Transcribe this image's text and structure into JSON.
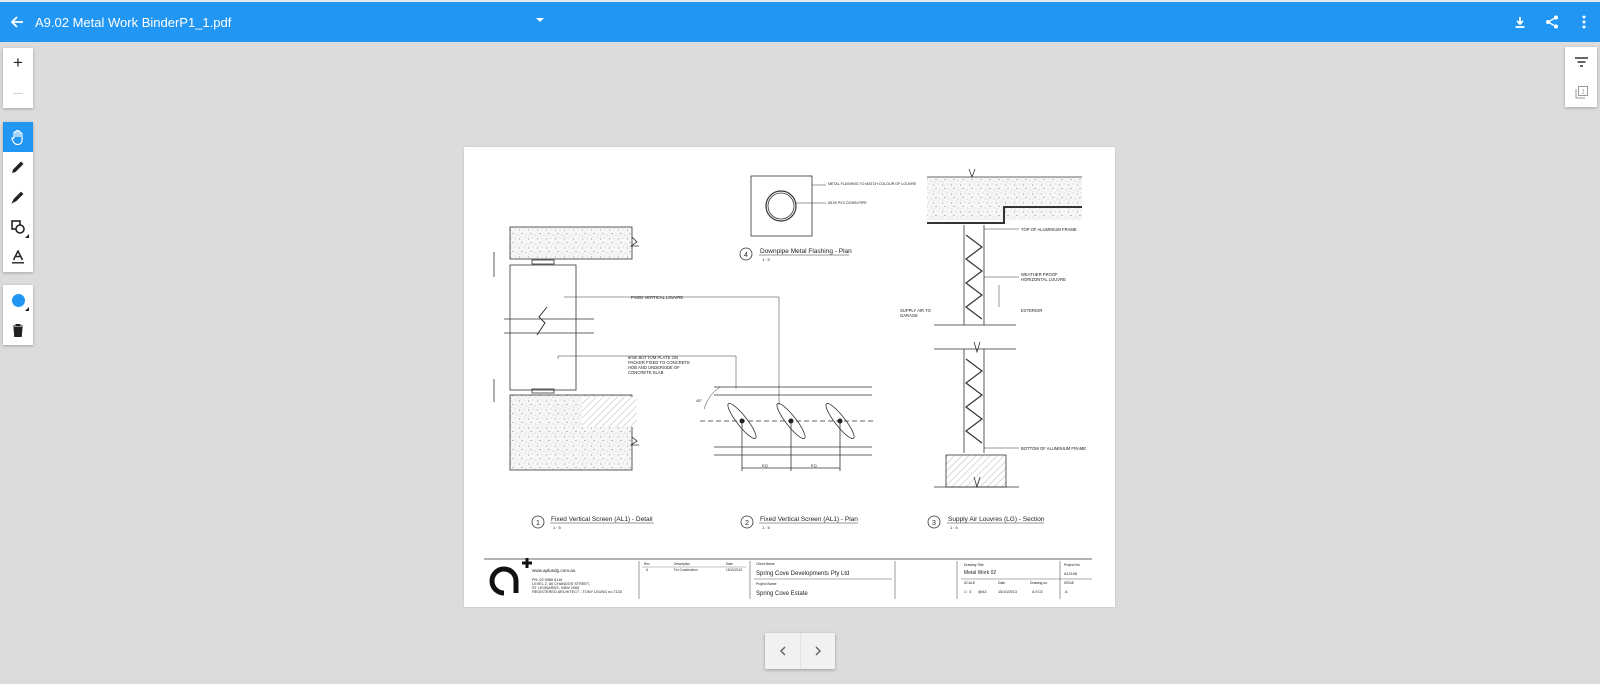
{
  "header": {
    "file_name": "A9.02 Metal Work BinderP1_1.pdf"
  },
  "colors": {
    "accent": "#2196f3",
    "background": "#dcdcdc"
  },
  "zoom_tools": {
    "zoom_in": "+",
    "zoom_out": "—"
  },
  "annotation_tools": [
    "pan-hand-icon",
    "pen-icon",
    "highlighter-icon",
    "shapes-icon",
    "text-icon"
  ],
  "drawing": {
    "callouts": {
      "metal_flashing": "METAL FLASHING TO MATCH COLOUR OF LOUVRE",
      "pvc_pipe": "Ø100 PVC DOWN PIPE",
      "fixed_vertical_louvre": "FIXED VERTICAL LOUVRE",
      "bottom_plate": [
        "6mm BOTTOM PLATE ON",
        "PACKER FIXED TO CONCRETE",
        "HOB AND UNDERSIDE OF",
        "CONCRETE SLAB"
      ],
      "top_frame": "TOP OF ALUMINIUM FRAME",
      "weather_proof": [
        "WEATHER PROOF",
        "HORIZONTAL LOUVRE"
      ],
      "exterior": "EXTERIOR",
      "supply_air": [
        "SUPPLY AIR TO",
        "GARAGE"
      ],
      "bottom_frame": "BOTTOM OF ALUMINIUM FRAME",
      "eq": "EQ",
      "angle": "45°"
    },
    "details": [
      {
        "num": "1",
        "title": "Fixed Vertical Screen (AL1) - Detail",
        "scale": "1 : 5"
      },
      {
        "num": "2",
        "title": "Fixed Vertical Screen (AL1) - Plan",
        "scale": "1 : 5"
      },
      {
        "num": "3",
        "title": "Supply Air Louvres (LG) - Section",
        "scale": "1 : 5"
      },
      {
        "num": "4",
        "title": "Downpipe Metal Flashing - Plan",
        "scale": "1 : 5"
      }
    ],
    "title_block": {
      "website": "www.aplusdg.com.au",
      "address": [
        "PH: 02 9966 6116",
        "LEVEL 2, 80 CHANDOS STREET,",
        "ST LEONARDS, NSW 2065",
        "REGISTERED ARCHITECT - TONY LEUNG no.7133"
      ],
      "revision_headers": [
        "Rev",
        "Description",
        "Date"
      ],
      "revision": [
        "A",
        "For Construction",
        "15/10/2013"
      ],
      "client_label": "Client Name",
      "client": "Spring Cove Developments Pty Ltd",
      "project_label": "Project Name",
      "project": "Spring Cove Estate",
      "drawing_title_label": "Drawing Title",
      "drawing_title": "Metal Work 02",
      "project_no_label": "Project No.",
      "project_no": "A12106",
      "scale_label": "SCALE",
      "scale": "1 : 5",
      "paper": "@A3",
      "date_label": "Date",
      "date": "15/10/2013",
      "drawing_no_label": "Drawing no.",
      "drawing_no": "A 9.02",
      "issue_label": "ISSUE",
      "issue": "A"
    }
  }
}
